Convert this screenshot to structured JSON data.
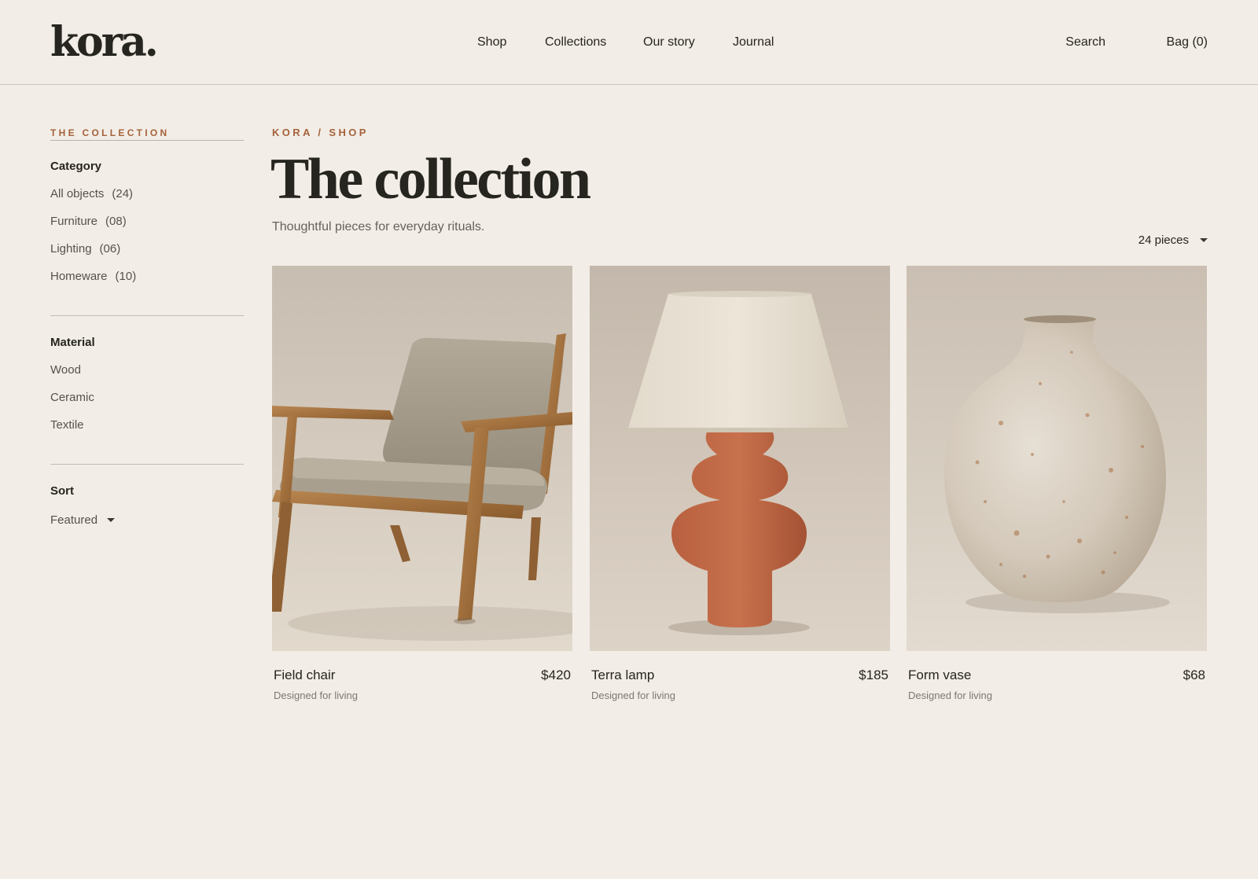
{
  "brand": {
    "logo": "kora."
  },
  "nav": [
    {
      "label": "Shop"
    },
    {
      "label": "Collections"
    },
    {
      "label": "Our story"
    },
    {
      "label": "Journal"
    }
  ],
  "utility": {
    "search": "Search",
    "bag": "Bag (0)"
  },
  "sidebar": {
    "eyebrow": "THE COLLECTION",
    "category": {
      "heading": "Category",
      "items": [
        {
          "label": "All objects",
          "count": "(24)"
        },
        {
          "label": "Furniture",
          "count": "(08)"
        },
        {
          "label": "Lighting",
          "count": "(06)"
        },
        {
          "label": "Homeware",
          "count": "(10)"
        }
      ]
    },
    "material": {
      "heading": "Material",
      "items": [
        {
          "label": "Wood"
        },
        {
          "label": "Ceramic"
        },
        {
          "label": "Textile"
        }
      ]
    },
    "sort": {
      "heading": "Sort",
      "value": "Featured"
    }
  },
  "main": {
    "breadcrumb": "KORA / SHOP",
    "title": "The collection",
    "subtitle": "Thoughtful pieces for everyday rituals.",
    "count_select": "24 pieces",
    "products": [
      {
        "name": "Field chair",
        "price": "$420",
        "tagline": "Designed for living",
        "image": "armchair-photo"
      },
      {
        "name": "Terra lamp",
        "price": "$185",
        "tagline": "Designed for living",
        "image": "table-lamp-photo"
      },
      {
        "name": "Form vase",
        "price": "$68",
        "tagline": "Designed for living",
        "image": "ceramic-vase-photo"
      }
    ]
  },
  "colors": {
    "background": "#f2ede6",
    "text": "#262520",
    "accent": "#a5623b",
    "muted": "#66625b"
  }
}
